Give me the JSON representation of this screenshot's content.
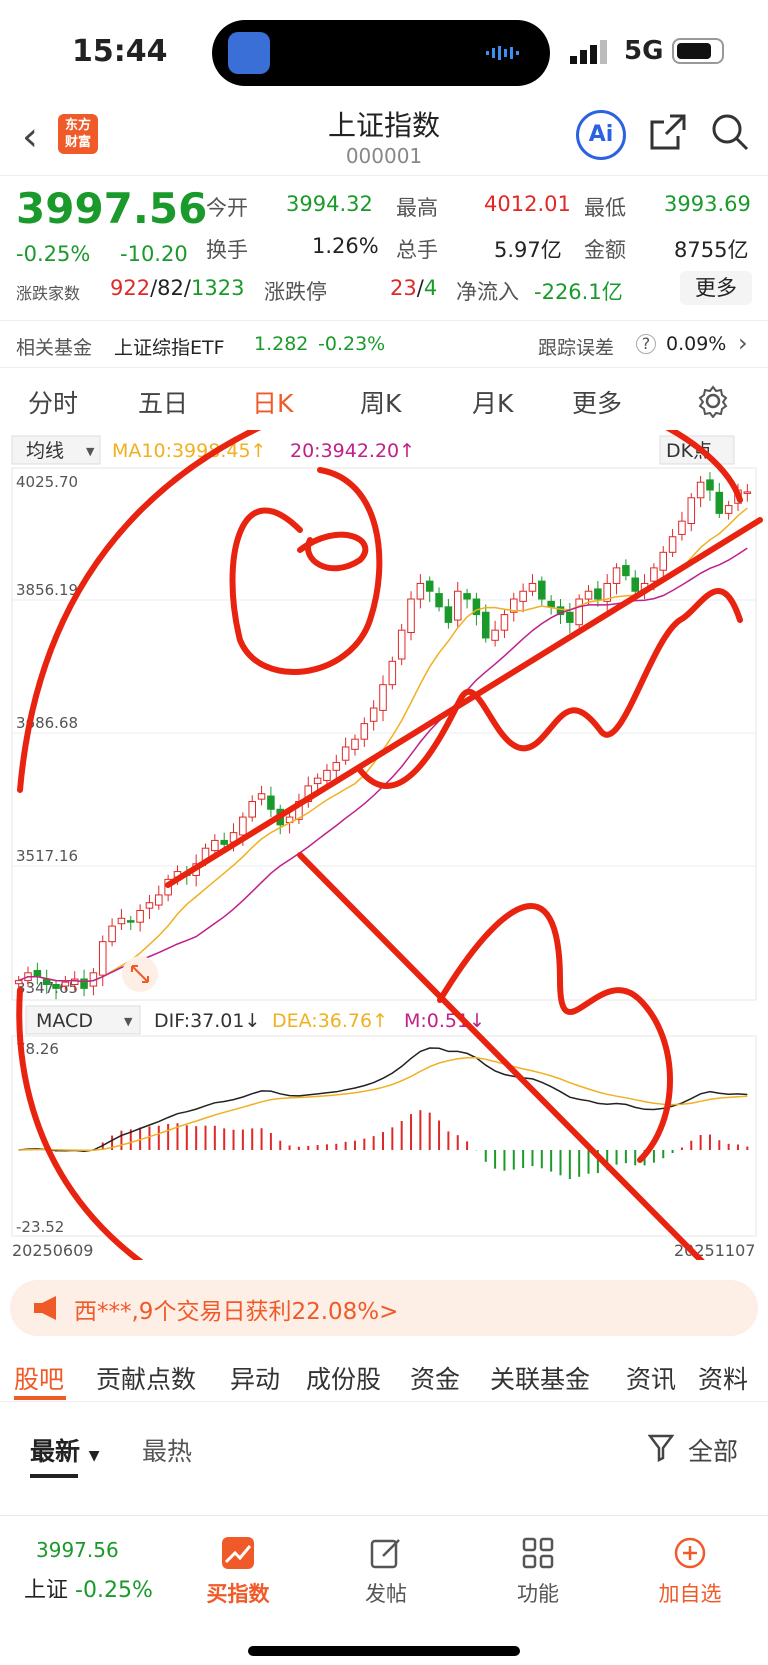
{
  "status": {
    "time": "15:44",
    "network": "5G"
  },
  "header": {
    "title": "上证指数",
    "code": "000001",
    "logo_text": "东方财富",
    "ai_label": "Ai"
  },
  "quote": {
    "price": "3997.56",
    "change_pct": "-0.25%",
    "change": "-10.20",
    "open_label": "今开",
    "open": "3994.32",
    "high_label": "最高",
    "high": "4012.01",
    "low_label": "最低",
    "low": "3993.69",
    "turnover_label": "换手",
    "turnover": "1.26%",
    "volume_label": "总手",
    "volume": "5.97亿",
    "amount_label": "金额",
    "amount": "8755亿",
    "breadth_label": "涨跌家数",
    "breadth_up": "922",
    "breadth_flat": "82",
    "breadth_down": "1323",
    "limit_label": "涨跌停",
    "limit_up": "23",
    "limit_down": "4",
    "inflow_label": "净流入",
    "inflow": "-226.1亿",
    "more_button": "更多"
  },
  "fund": {
    "label": "相关基金",
    "name": "上证综指ETF",
    "price": "1.282",
    "change": "-0.23%",
    "tracking_label": "跟踪误差",
    "tracking": "0.09%"
  },
  "period_tabs": [
    "分时",
    "五日",
    "日K",
    "周K",
    "月K",
    "更多"
  ],
  "active_period": 2,
  "chart_data": [
    {
      "type": "candlestick",
      "indicator_select": "均线",
      "ma10_label": "MA10:3998.45↑",
      "ma20_label": "20:3942.20↑",
      "dk_label": "DK点",
      "y_ticks": [
        "4025.70",
        "3856.19",
        "3686.68",
        "3517.16",
        "3347.65"
      ],
      "ylim": [
        3347.65,
        4025.7
      ],
      "close_approx": [
        3370,
        3380,
        3375,
        3365,
        3360,
        3368,
        3372,
        3360,
        3380,
        3420,
        3440,
        3450,
        3445,
        3460,
        3470,
        3480,
        3500,
        3510,
        3505,
        3520,
        3540,
        3550,
        3545,
        3560,
        3580,
        3600,
        3610,
        3590,
        3570,
        3580,
        3600,
        3620,
        3630,
        3640,
        3650,
        3670,
        3680,
        3700,
        3720,
        3750,
        3780,
        3820,
        3860,
        3880,
        3870,
        3850,
        3830,
        3870,
        3860,
        3840,
        3810,
        3820,
        3840,
        3860,
        3870,
        3880,
        3860,
        3850,
        3840,
        3830,
        3860,
        3870,
        3860,
        3880,
        3900,
        3890,
        3870,
        3880,
        3900,
        3920,
        3940,
        3960,
        3990,
        4010,
        4000,
        3970,
        3980,
        4000,
        3997.56
      ]
    },
    {
      "type": "macd",
      "indicator_select": "MACD",
      "dif_label": "DIF:37.01↓",
      "dea_label": "DEA:36.76↑",
      "m_label": "M:0.51↓",
      "y_ticks": [
        "78.26",
        "-23.52"
      ],
      "x_labels": [
        "20250609",
        "20251107"
      ]
    }
  ],
  "promo": {
    "text": "西***,9个交易日获利22.08%>"
  },
  "content_tabs": [
    "股吧",
    "贡献点数",
    "异动",
    "成份股",
    "资金",
    "关联基金",
    "资讯",
    "资料"
  ],
  "sub_tabs": {
    "latest": "最新",
    "hot": "最热",
    "filter": "全部"
  },
  "bottom": {
    "price": "3997.56",
    "name": "上证",
    "change": "-0.25%",
    "items": [
      "买指数",
      "发帖",
      "功能",
      "加自选"
    ]
  },
  "colors": {
    "up": "#e02828",
    "down": "#1a9a2a",
    "accent": "#f05a28",
    "ma10": "#f0b020",
    "ma20": "#c0208a"
  }
}
